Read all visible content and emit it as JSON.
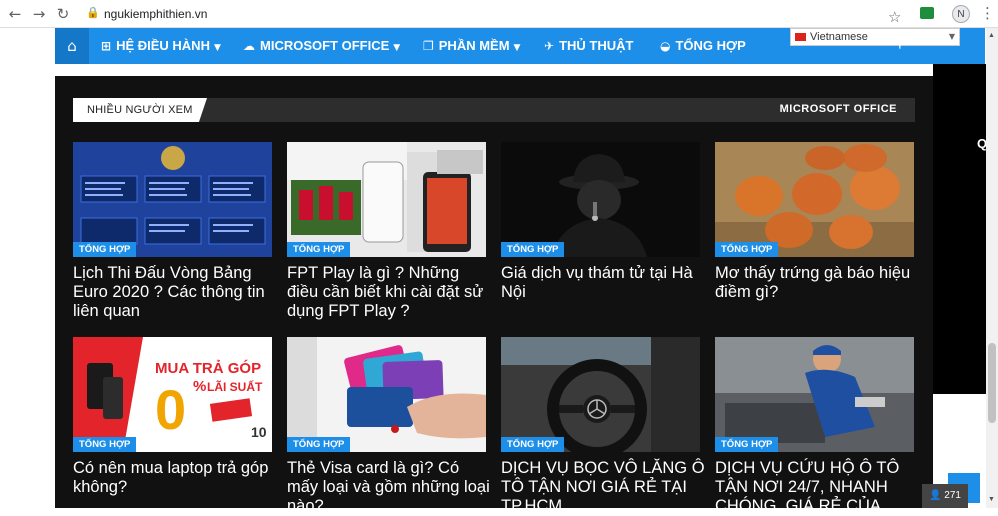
{
  "browser": {
    "back_icon": "back-arrow-icon",
    "forward_icon": "forward-arrow-icon",
    "reload_icon": "reload-icon",
    "url": "ngukiemphithien.vn",
    "profile_initial": "N"
  },
  "nav": {
    "home_icon": "home-icon",
    "items": [
      {
        "label": "HỆ ĐIỀU HÀNH",
        "icon": "windows-icon"
      },
      {
        "label": "MICROSOFT OFFICE",
        "icon": "cloud-icon"
      },
      {
        "label": "PHẦN MỀM",
        "icon": "copy-icon"
      },
      {
        "label": "THỦ THUẬT",
        "icon": "wrench-icon"
      },
      {
        "label": "TỔNG HỢP",
        "icon": "car-icon"
      }
    ],
    "language": "Vietnamese"
  },
  "section": {
    "heading": "NHIỀU NGƯỜI XEM",
    "category_link": "MICROSOFT OFFICE"
  },
  "side_text": "Q",
  "posts": [
    {
      "category": "TỔNG HỢP",
      "title": "Lịch Thi Đấu Vòng Bảng Euro 2020 ? Các thông tin liên quan",
      "image": "euro-2020-groups"
    },
    {
      "category": "TỔNG HỢP",
      "title": "FPT Play là gì ? Những điều cần biết khi cài đặt sử dụng FPT Play ?",
      "image": "fpt-play-devices"
    },
    {
      "category": "TỔNG HỢP",
      "title": "Giá dịch vụ thám tử tại Hà Nội",
      "image": "detective-hat"
    },
    {
      "category": "TỔNG HỢP",
      "title": "Mơ thấy trứng gà báo hiệu điềm gì?",
      "image": "eggs-on-burlap"
    },
    {
      "category": "TỔNG HỢP",
      "title": "Có nên mua laptop trả góp không?",
      "image": "installment-ad"
    },
    {
      "category": "TỔNG HỢP",
      "title": "Thẻ Visa card là gì? Có mấy loại và gồm những loại nào?",
      "image": "visa-cards-hand"
    },
    {
      "category": "TỔNG HỢP",
      "title": "DỊCH VỤ BỌC VÔ LĂNG Ô TÔ TẬN NƠI GIÁ RẺ TẠI TP.HCM",
      "image": "steering-wheel"
    },
    {
      "category": "TỔNG HỢP",
      "title": "DỊCH VỤ CỨU HỘ Ô TÔ TẬN NƠI 24/7, NHANH CHÓNG, GIÁ RẺ CỦA",
      "image": "car-mechanic"
    }
  ],
  "promo": {
    "line1": "MUA TRẢ GÓP",
    "line2": "LÃI SUẤT",
    "big": "0",
    "pct": "%",
    "sub": "10"
  },
  "counter": "271"
}
